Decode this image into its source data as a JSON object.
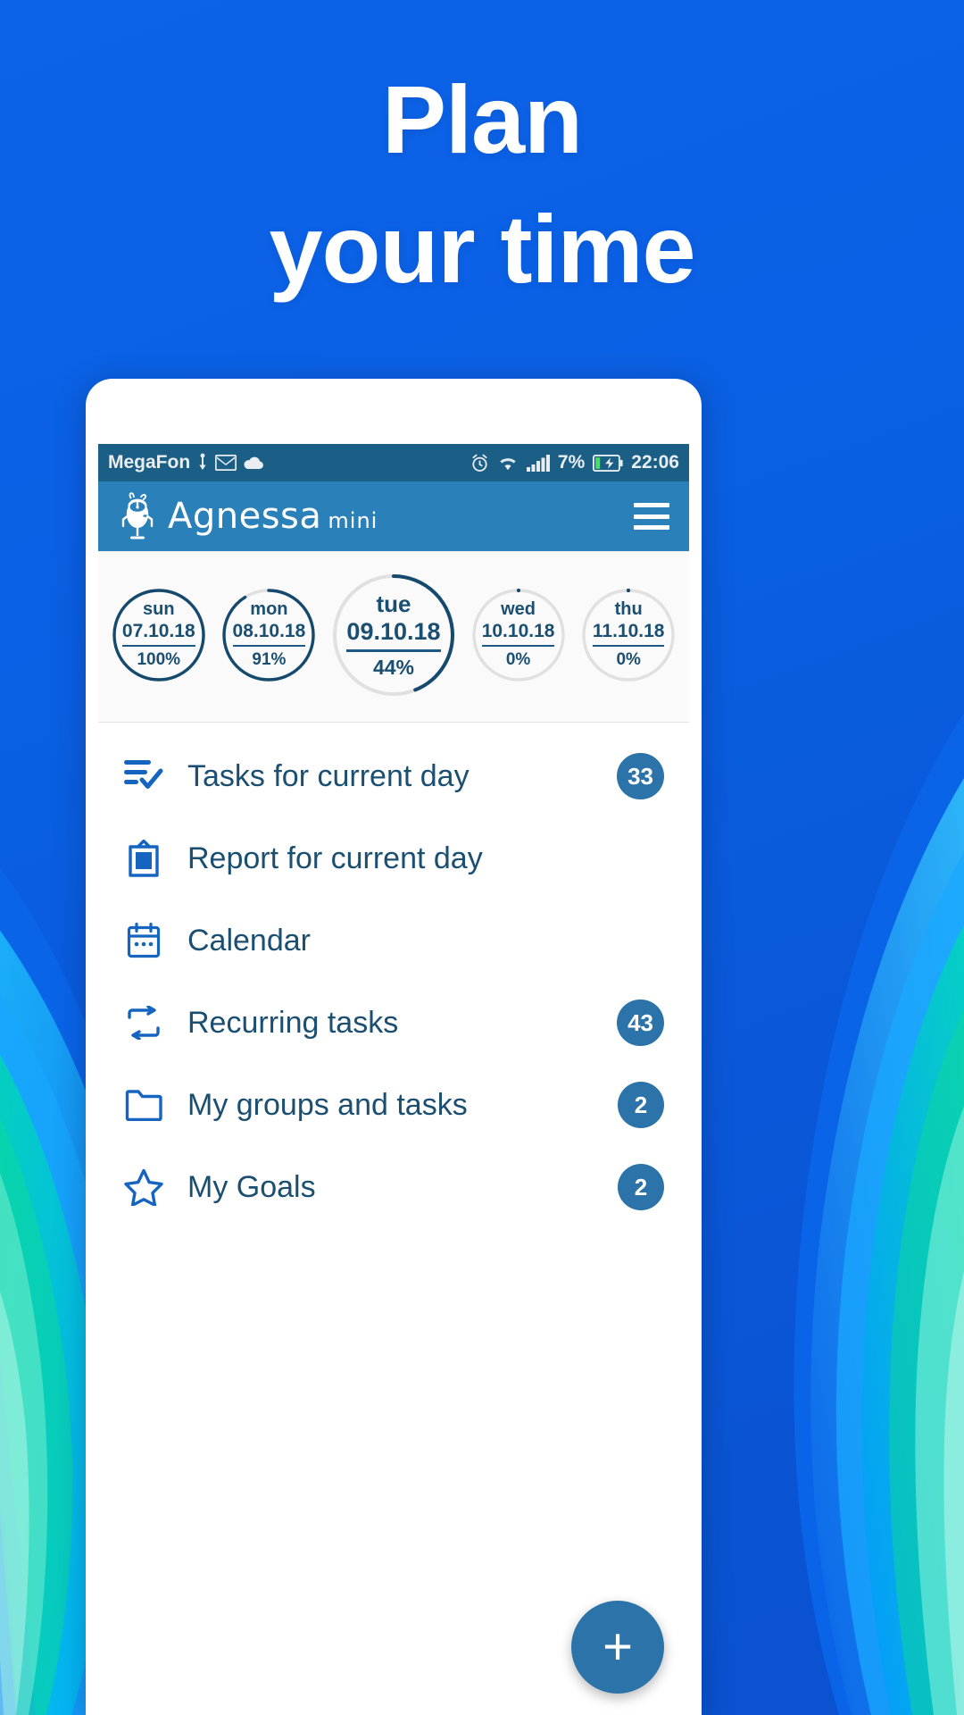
{
  "promo": {
    "headline_line1": "Plan",
    "headline_line2": "your time",
    "background_color": "#0a5fe3",
    "accent_color": "#ffffff"
  },
  "phone": {
    "status_bar": {
      "carrier": "MegaFon",
      "usb_icon": "usb-icon",
      "mail_icon": "mail-icon",
      "cloud_icon": "cloud-icon",
      "alarm_icon": "alarm-icon",
      "wifi_icon": "wifi-icon",
      "signal_icon": "signal-bars-icon",
      "battery_percent": "7%",
      "battery_icon": "battery-charging-icon",
      "time": "22:06",
      "background_color": "#1c5f86"
    },
    "app_bar": {
      "logo_icon": "robot-mascot-icon",
      "brand_name": "Agnessa",
      "brand_suffix": "mini",
      "menu_icon": "hamburger-menu-icon",
      "background_color": "#2a80b9"
    },
    "days": [
      {
        "name": "sun",
        "date": "07.10.18",
        "percent": "100%",
        "value": 100,
        "size": "small"
      },
      {
        "name": "mon",
        "date": "08.10.18",
        "percent": "91%",
        "value": 91,
        "size": "small"
      },
      {
        "name": "tue",
        "date": "09.10.18",
        "percent": "44%",
        "value": 44,
        "size": "large"
      },
      {
        "name": "wed",
        "date": "10.10.18",
        "percent": "0%",
        "value": 0,
        "size": "small"
      },
      {
        "name": "thu",
        "date": "11.10.18",
        "percent": "0%",
        "value": 0,
        "size": "small"
      }
    ],
    "menu_items": [
      {
        "label": "Tasks for current day",
        "icon": "task-list-check-icon",
        "badge": "33"
      },
      {
        "label": "Report for current day",
        "icon": "clipboard-icon",
        "badge": ""
      },
      {
        "label": "Calendar",
        "icon": "calendar-icon",
        "badge": ""
      },
      {
        "label": "Recurring tasks",
        "icon": "repeat-icon",
        "badge": "43"
      },
      {
        "label": "My groups and tasks",
        "icon": "folder-icon",
        "badge": "2"
      },
      {
        "label": "My Goals",
        "icon": "star-icon",
        "badge": "2"
      }
    ],
    "fab": {
      "label": "+",
      "icon": "plus-icon",
      "color": "#2b73a8"
    },
    "colors": {
      "primary": "#2a80b9",
      "dark": "#1c5f86",
      "text": "#1b4f72",
      "badge": "#2b73a8"
    }
  }
}
